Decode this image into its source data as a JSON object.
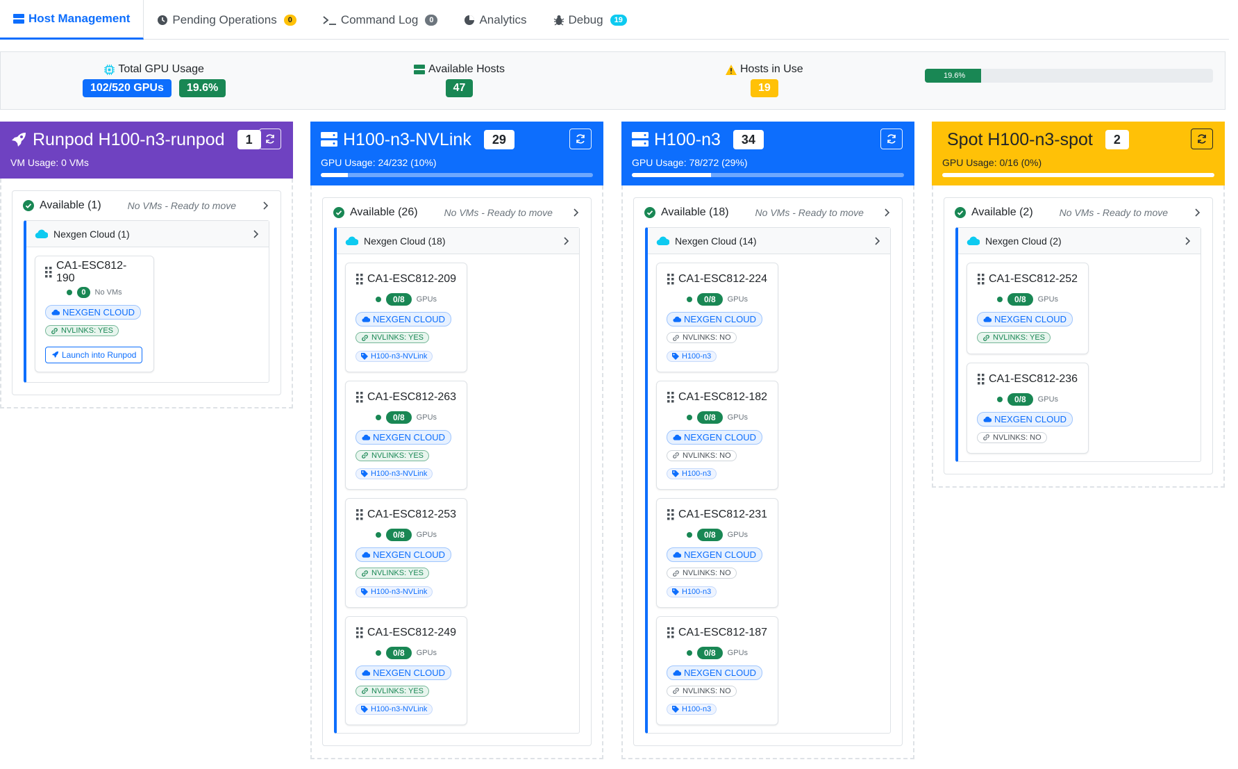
{
  "tabs": [
    {
      "label": "Host Management",
      "badge": ""
    },
    {
      "label": "Pending Operations",
      "badge": "0"
    },
    {
      "label": "Command Log",
      "badge": "0"
    },
    {
      "label": "Analytics",
      "badge": ""
    },
    {
      "label": "Debug",
      "badge": "19"
    }
  ],
  "summary": {
    "gpu_label": "Total GPU Usage",
    "gpu_count": "102/520 GPUs",
    "gpu_percent": "19.6%",
    "available_label": "Available Hosts",
    "available_count": "47",
    "in_use_label": "Hosts in Use",
    "in_use_count": "19",
    "progress_label": "19.6%",
    "progress_value": 0.196
  },
  "columns": [
    {
      "title": "Runpod H100-n3-runpod",
      "count": "1",
      "usage": "VM Usage: 0 VMs",
      "section_label": "Available (1)",
      "section_note": "No VMs - Ready to move",
      "provider": "Nexgen Cloud (1)",
      "hosts": [
        {
          "name": "CA1-ESC812-190",
          "count": "0",
          "unit": "No VMs",
          "cloud": "NEXGEN CLOUD",
          "nvlinks": "NVLINKS: YES",
          "launch": "Launch into Runpod"
        }
      ]
    },
    {
      "title": "H100-n3-NVLink",
      "count": "29",
      "usage": "GPU Usage: 24/232 (10%)",
      "usage_value": 0.1,
      "section_label": "Available (26)",
      "section_note": "No VMs - Ready to move",
      "provider": "Nexgen Cloud (18)",
      "hosts": [
        {
          "name": "CA1-ESC812-209",
          "gpus": "0/8",
          "unit": "GPUs",
          "cloud": "NEXGEN CLOUD",
          "nvlinks": "NVLINKS: YES",
          "type": "H100-n3-NVLink"
        },
        {
          "name": "CA1-ESC812-263",
          "gpus": "0/8",
          "unit": "GPUs",
          "cloud": "NEXGEN CLOUD",
          "nvlinks": "NVLINKS: YES",
          "type": "H100-n3-NVLink"
        },
        {
          "name": "CA1-ESC812-253",
          "gpus": "0/8",
          "unit": "GPUs",
          "cloud": "NEXGEN CLOUD",
          "nvlinks": "NVLINKS: YES",
          "type": "H100-n3-NVLink"
        },
        {
          "name": "CA1-ESC812-249",
          "gpus": "0/8",
          "unit": "GPUs",
          "cloud": "NEXGEN CLOUD",
          "nvlinks": "NVLINKS: YES",
          "type": "H100-n3-NVLink"
        }
      ]
    },
    {
      "title": "H100-n3",
      "count": "34",
      "usage": "GPU Usage: 78/272 (29%)",
      "usage_value": 0.29,
      "section_label": "Available (18)",
      "section_note": "No VMs - Ready to move",
      "provider": "Nexgen Cloud (14)",
      "hosts": [
        {
          "name": "CA1-ESC812-224",
          "gpus": "0/8",
          "unit": "GPUs",
          "cloud": "NEXGEN CLOUD",
          "nvlinks": "NVLINKS: NO",
          "type": "H100-n3"
        },
        {
          "name": "CA1-ESC812-182",
          "gpus": "0/8",
          "unit": "GPUs",
          "cloud": "NEXGEN CLOUD",
          "nvlinks": "NVLINKS: NO",
          "type": "H100-n3"
        },
        {
          "name": "CA1-ESC812-231",
          "gpus": "0/8",
          "unit": "GPUs",
          "cloud": "NEXGEN CLOUD",
          "nvlinks": "NVLINKS: NO",
          "type": "H100-n3"
        },
        {
          "name": "CA1-ESC812-187",
          "gpus": "0/8",
          "unit": "GPUs",
          "cloud": "NEXGEN CLOUD",
          "nvlinks": "NVLINKS: NO",
          "type": "H100-n3"
        }
      ]
    },
    {
      "title": "Spot H100-n3-spot",
      "count": "2",
      "usage": "GPU Usage: 0/16 (0%)",
      "usage_value": 0.0,
      "section_label": "Available (2)",
      "section_note": "No VMs - Ready to move",
      "provider": "Nexgen Cloud (2)",
      "hosts": [
        {
          "name": "CA1-ESC812-252",
          "gpus": "0/8",
          "unit": "GPUs",
          "cloud": "NEXGEN CLOUD",
          "nvlinks": "NVLINKS: YES"
        },
        {
          "name": "CA1-ESC812-236",
          "gpus": "0/8",
          "unit": "GPUs",
          "cloud": "NEXGEN CLOUD",
          "nvlinks": "NVLINKS: NO"
        }
      ]
    }
  ],
  "colors": {
    "primary": "#0d6efd",
    "runpod": "#6f42c1",
    "spot": "#ffc107",
    "success": "#198754"
  }
}
